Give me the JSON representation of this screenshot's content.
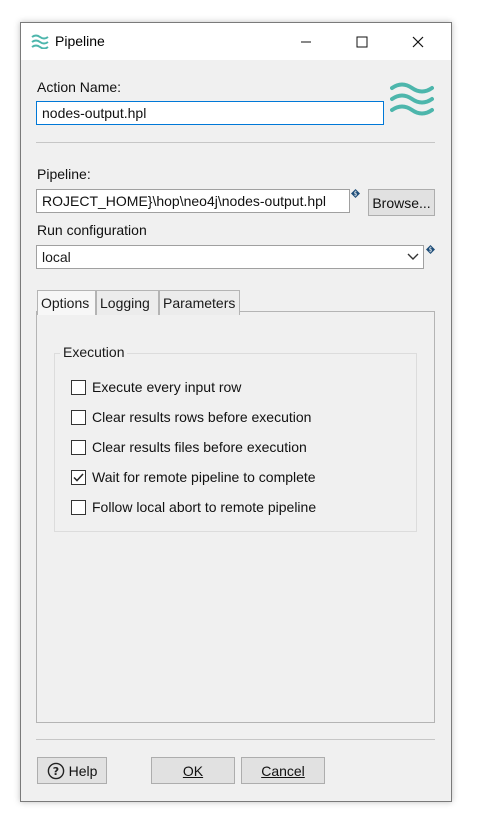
{
  "window": {
    "title": "Pipeline",
    "icon": "hop-waves-icon"
  },
  "form": {
    "action_name_label": "Action Name:",
    "action_name_value": "nodes-output.hpl",
    "pipeline_label": "Pipeline:",
    "pipeline_value": "ROJECT_HOME}\\hop\\neo4j\\nodes-output.hpl",
    "browse_label": "Browse...",
    "run_config_label": "Run configuration",
    "run_config_value": "local"
  },
  "tabs": [
    {
      "label": "Options",
      "active": true
    },
    {
      "label": "Logging",
      "active": false
    },
    {
      "label": "Parameters",
      "active": false
    }
  ],
  "execution": {
    "group_title": "Execution",
    "options": [
      {
        "label": "Execute every input row",
        "checked": false
      },
      {
        "label": "Clear results rows before execution",
        "checked": false
      },
      {
        "label": "Clear results files before execution",
        "checked": false
      },
      {
        "label": "Wait for remote pipeline to complete",
        "checked": true
      },
      {
        "label": "Follow local abort to remote pipeline",
        "checked": false
      }
    ]
  },
  "footer": {
    "help_label": "Help",
    "ok_label": "OK",
    "cancel_label": "Cancel"
  },
  "colors": {
    "accent": "#4db6ac",
    "focus": "#0078d7",
    "variable_icon": "#1f4e79"
  }
}
